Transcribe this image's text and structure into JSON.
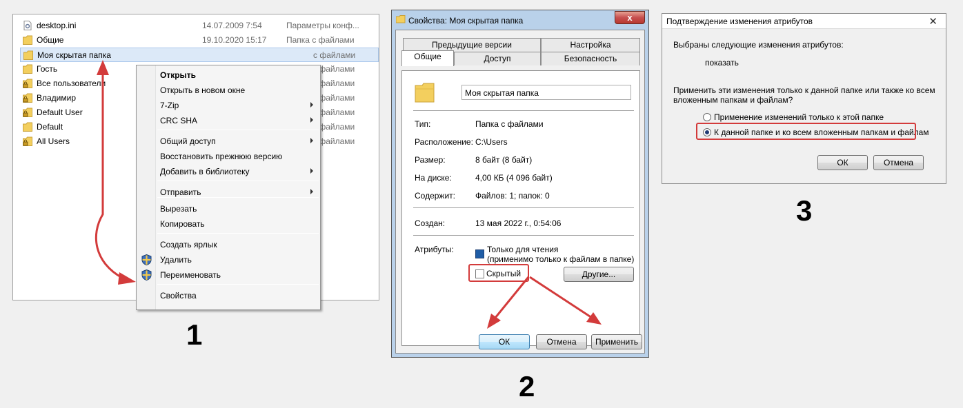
{
  "explorer": {
    "files": [
      {
        "name": "desktop.ini",
        "date": "14.07.2009 7:54",
        "type": "Параметры конф...",
        "icon": "ini-file-icon"
      },
      {
        "name": "Общие",
        "date": "19.10.2020 15:17",
        "type": "Папка с файлами",
        "icon": "folder-icon"
      },
      {
        "name": "Моя скрытая папка",
        "date": "",
        "type": "с файлами",
        "icon": "folder-icon"
      },
      {
        "name": "Гость",
        "date": "",
        "type": "с файлами",
        "icon": "folder-icon"
      },
      {
        "name": "Все пользователи",
        "date": "",
        "type": "с файлами",
        "icon": "folder-lock-icon"
      },
      {
        "name": "Владимир",
        "date": "",
        "type": "с файлами",
        "icon": "folder-lock-icon"
      },
      {
        "name": "Default User",
        "date": "",
        "type": "с файлами",
        "icon": "folder-lock-icon"
      },
      {
        "name": "Default",
        "date": "",
        "type": "с файлами",
        "icon": "folder-icon"
      },
      {
        "name": "All Users",
        "date": "",
        "type": "с файлами",
        "icon": "folder-lock-icon"
      }
    ],
    "context_menu": [
      {
        "label": "Открыть",
        "bold": true
      },
      {
        "label": "Открыть в новом окне"
      },
      {
        "label": "7-Zip",
        "submenu": true
      },
      {
        "label": "CRC SHA",
        "submenu": true
      },
      {
        "label": "Общий доступ",
        "submenu": true
      },
      {
        "label": "Восстановить прежнюю версию"
      },
      {
        "label": "Добавить в библиотеку",
        "submenu": true
      },
      {
        "label": "Отправить",
        "submenu": true
      },
      {
        "label": "Вырезать"
      },
      {
        "label": "Копировать"
      },
      {
        "label": "Создать ярлык"
      },
      {
        "label": "Удалить",
        "icon": "shield-icon"
      },
      {
        "label": "Переименовать",
        "icon": "shield-icon"
      },
      {
        "label": "Свойства"
      }
    ],
    "step": "1"
  },
  "properties": {
    "title": "Свойства: Моя скрытая папка",
    "close": "x",
    "tabs_top": [
      "Предыдущие версии",
      "Настройка"
    ],
    "tabs_bottom": [
      "Общие",
      "Доступ",
      "Безопасность"
    ],
    "folder_name": "Моя скрытая папка",
    "rows": [
      {
        "label": "Тип:",
        "value": "Папка с файлами"
      },
      {
        "label": "Расположение:",
        "value": "C:\\Users"
      },
      {
        "label": "Размер:",
        "value": "8 байт (8 байт)"
      },
      {
        "label": "На диске:",
        "value": "4,00 КБ (4 096 байт)"
      },
      {
        "label": "Содержит:",
        "value": "Файлов: 1; папок: 0"
      },
      {
        "label": "Создан:",
        "value": "13 мая 2022 г., 0:54:06"
      }
    ],
    "attributes_label": "Атрибуты:",
    "readonly_label": "Только для чтения",
    "readonly_note": "(применимо только к файлам в папке)",
    "hidden_label": "Скрытый",
    "other_button": "Другие...",
    "ok": "ОК",
    "cancel": "Отмена",
    "apply": "Применить",
    "step": "2"
  },
  "confirm": {
    "title": "Подтверждение изменения атрибутов",
    "close": "✕",
    "intro": "Выбраны следующие изменения атрибутов:",
    "change": "показать",
    "question_line1": "Применить эти изменения только к данной папке или также ко всем",
    "question_line2": "вложенным папкам и файлам?",
    "option1": "Применение изменений только к этой папке",
    "option2": "К данной папке и ко всем вложенным папкам и файлам",
    "selected_option": 2,
    "ok": "ОК",
    "cancel": "Отмена",
    "step": "3"
  },
  "colors": {
    "highlight_red": "#d33b3b",
    "selection_blue": "#dce9f8",
    "folder_yellow": "#f3cf5e"
  }
}
